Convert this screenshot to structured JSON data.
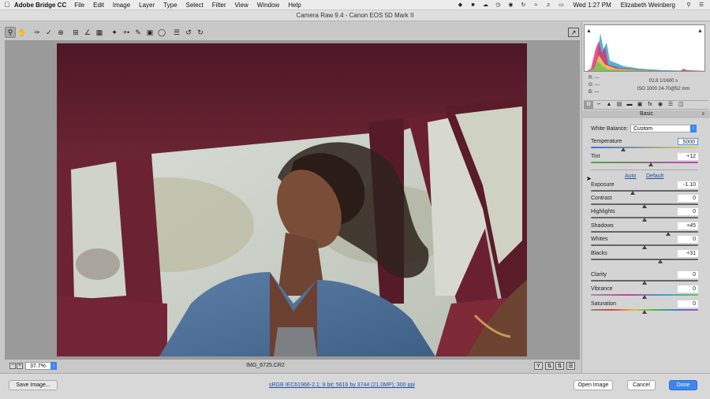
{
  "menubar": {
    "apple": "",
    "app_name": "Adobe Bridge CC",
    "items": [
      "File",
      "Edit",
      "Image",
      "Layer",
      "Type",
      "Select",
      "Filter",
      "View",
      "Window",
      "Help"
    ],
    "clock": "Wed 1:27 PM",
    "user": "Elizabeth Weinberg"
  },
  "window": {
    "title": "Camera Raw 9.4 - Canon EOS 5D Mark II"
  },
  "preview": {
    "zoom": "37.7%",
    "filename": "IMG_6725.CR2"
  },
  "readout": {
    "r": "R:  ---",
    "g": "G:  ---",
    "b": "B:  ---",
    "aperture_shutter": "f/2.8   1/1600 s",
    "iso_lens": "ISO 1000   24-70@52 mm"
  },
  "panel": {
    "title": "Basic",
    "white_balance_label": "White Balance:",
    "white_balance_value": "Custom",
    "auto": "Auto",
    "default": "Default",
    "sliders": {
      "temperature": {
        "label": "Temperature",
        "value": "5000",
        "pos": 0.3
      },
      "tint": {
        "label": "Tint",
        "value": "+12",
        "pos": 0.56
      },
      "exposure": {
        "label": "Exposure",
        "value": "-1.10",
        "pos": 0.39
      },
      "contrast": {
        "label": "Contrast",
        "value": "0",
        "pos": 0.5
      },
      "highlights": {
        "label": "Highlights",
        "value": "0",
        "pos": 0.5
      },
      "shadows": {
        "label": "Shadows",
        "value": "+45",
        "pos": 0.72
      },
      "whites": {
        "label": "Whites",
        "value": "0",
        "pos": 0.5
      },
      "blacks": {
        "label": "Blacks",
        "value": "+31",
        "pos": 0.65
      },
      "clarity": {
        "label": "Clarity",
        "value": "0",
        "pos": 0.5
      },
      "vibrance": {
        "label": "Vibrance",
        "value": "0",
        "pos": 0.5
      },
      "saturation": {
        "label": "Saturation",
        "value": "0",
        "pos": 0.5
      }
    }
  },
  "bottom": {
    "save_image": "Save Image...",
    "workflow": "sRGB IEC61966-2.1; 8 bit; 5616 by 3744 (21.0MP); 300 ppi",
    "open_image": "Open Image",
    "cancel": "Cancel",
    "done": "Done"
  },
  "colors": {
    "accent": "#3b86f0",
    "link": "#1f4fa8"
  }
}
